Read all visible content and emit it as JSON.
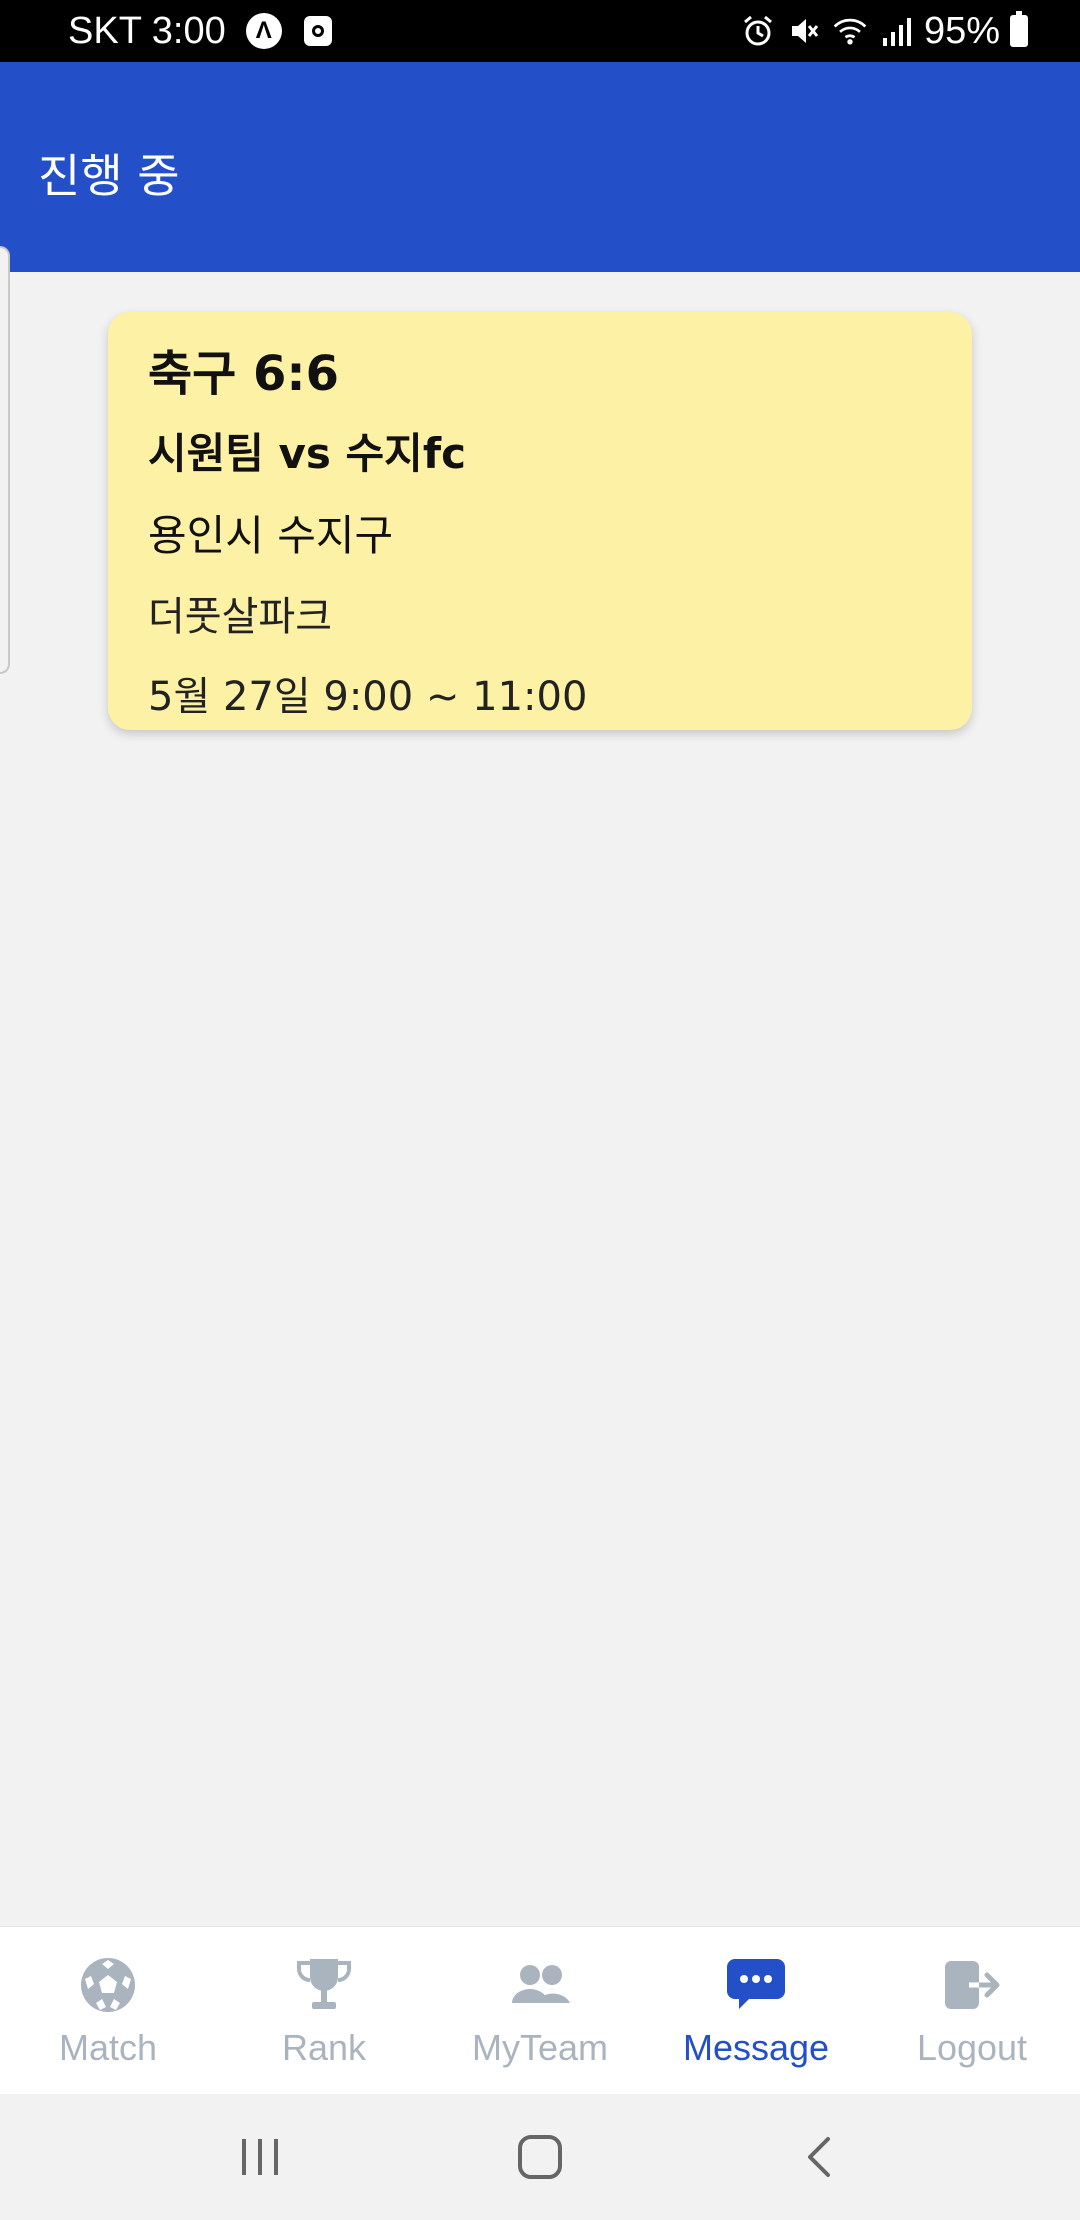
{
  "status_bar": {
    "carrier_time": "SKT 3:00",
    "battery": "95%"
  },
  "header": {
    "title": "진행 중"
  },
  "match_card": {
    "sport": "축구 6:6",
    "teams": "시원팀 vs 수지fc",
    "region": "용인시 수지구",
    "venue": "더풋살파크",
    "time": "5월 27일 9:00 ~ 11:00"
  },
  "bottom_nav": {
    "active": "Message",
    "active_color": "#2350c9",
    "inactive_color": "#aab4bf",
    "items": [
      {
        "label": "Match",
        "icon": "soccer-ball-icon"
      },
      {
        "label": "Rank",
        "icon": "trophy-icon"
      },
      {
        "label": "MyTeam",
        "icon": "users-icon"
      },
      {
        "label": "Message",
        "icon": "chat-bubble-icon"
      },
      {
        "label": "Logout",
        "icon": "logout-icon"
      }
    ]
  },
  "colors": {
    "header_bg": "#2350c9",
    "card_bg": "#fcf1a4",
    "page_bg": "#f2f2f2"
  }
}
